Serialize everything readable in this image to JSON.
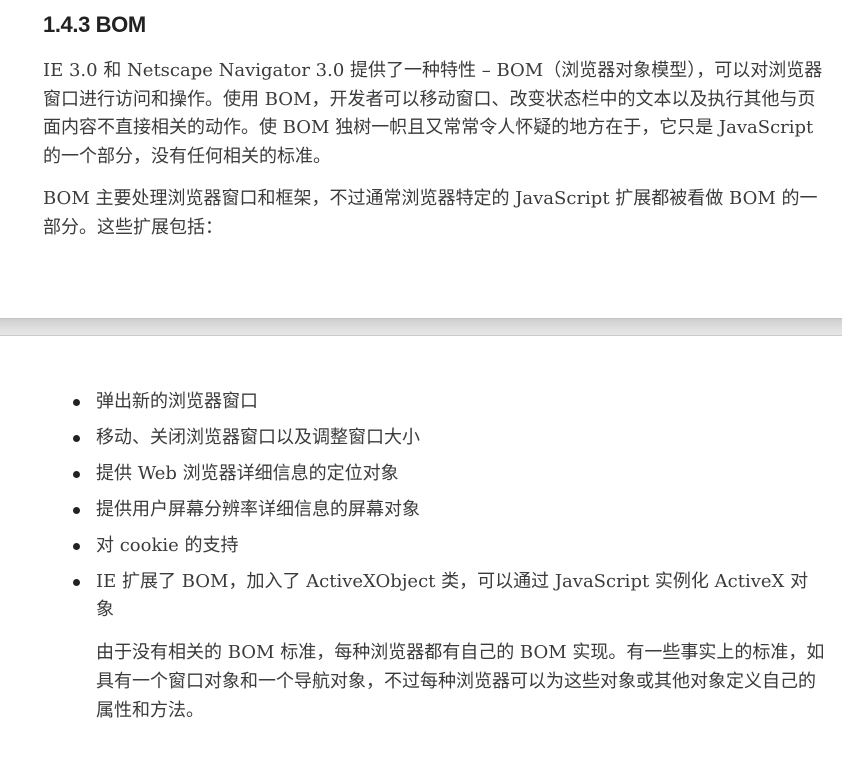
{
  "section": {
    "heading": "1.4.3 BOM",
    "paragraphs": [
      "IE 3.0 和 Netscape Navigator 3.0 提供了一种特性 – BOM（浏览器对象模型），可以对浏览器窗口进行访问和操作。使用 BOM，开发者可以移动窗口、改变状态栏中的文本以及执行其他与页面内容不直接相关的动作。使 BOM 独树一帜且又常常令人怀疑的地方在于，它只是 JavaScript 的一个部分，没有任何相关的标准。",
      "BOM 主要处理浏览器窗口和框架，不过通常浏览器特定的 JavaScript 扩展都被看做 BOM 的一部分。这些扩展包括："
    ]
  },
  "list": {
    "items": [
      "弹出新的浏览器窗口",
      "移动、关闭浏览器窗口以及调整窗口大小",
      "提供 Web 浏览器详细信息的定位对象",
      "提供用户屏幕分辨率详细信息的屏幕对象",
      "对 cookie 的支持",
      "IE 扩展了 BOM，加入了 ActiveXObject 类，可以通过 JavaScript 实例化 ActiveX 对象"
    ]
  },
  "follow_paragraph": "由于没有相关的 BOM 标准，每种浏览器都有自己的 BOM 实现。有一些事实上的标准，如具有一个窗口对象和一个导航对象，不过每种浏览器可以为这些对象或其他对象定义自己的属性和方法。",
  "colors": {
    "text": "#3b3b3b",
    "heading": "#222222",
    "page_break": "#dddddd"
  }
}
